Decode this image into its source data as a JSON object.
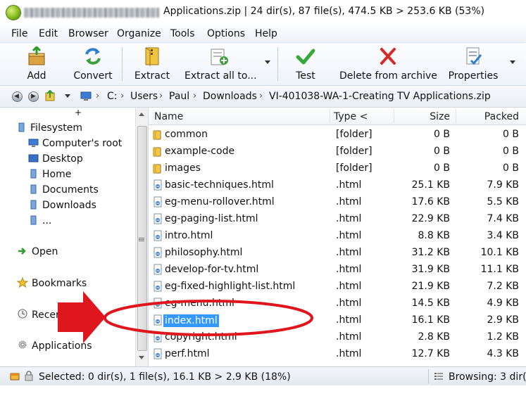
{
  "window": {
    "title": "Applications.zip | 24 dir(s), 87 file(s), 474.5 KB > 253.6 KB (53%)"
  },
  "menu": [
    "File",
    "Edit",
    "Browser",
    "Organize",
    "Tools",
    "Options",
    "Help"
  ],
  "toolbar": {
    "add": "Add",
    "convert": "Convert",
    "extract": "Extract",
    "extract_all": "Extract all to...",
    "test": "Test",
    "delete": "Delete from archive",
    "properties": "Properties"
  },
  "address": {
    "crumbs": [
      "C:",
      "Users",
      "Paul",
      "Downloads",
      "VI-401038-WA-1-Creating TV Applications.zip"
    ]
  },
  "sidebar": {
    "plus": "+",
    "filesystem": "Filesystem",
    "items": [
      "Computer's root",
      "Desktop",
      "Home",
      "Documents",
      "Downloads",
      "..."
    ],
    "open": "Open",
    "bookmarks": "Bookmarks",
    "recent": "Recent files",
    "applications": "Applications"
  },
  "columns": {
    "name": "Name",
    "type": "Type <",
    "size": "Size",
    "packed": "Packed"
  },
  "files": [
    {
      "name": "common",
      "type": "[folder]",
      "size": "0 B",
      "packed": "0 B",
      "kind": "folder"
    },
    {
      "name": "example-code",
      "type": "[folder]",
      "size": "0 B",
      "packed": "0 B",
      "kind": "folder"
    },
    {
      "name": "images",
      "type": "[folder]",
      "size": "0 B",
      "packed": "0 B",
      "kind": "folder"
    },
    {
      "name": "basic-techniques.html",
      "type": ".html",
      "size": "25.1 KB",
      "packed": "7.9 KB",
      "kind": "html"
    },
    {
      "name": "eg-menu-rollover.html",
      "type": ".html",
      "size": "17.6 KB",
      "packed": "5.5 KB",
      "kind": "html"
    },
    {
      "name": "eg-paging-list.html",
      "type": ".html",
      "size": "22.9 KB",
      "packed": "7.4 KB",
      "kind": "html"
    },
    {
      "name": "intro.html",
      "type": ".html",
      "size": "8.8 KB",
      "packed": "3.4 KB",
      "kind": "html"
    },
    {
      "name": "philosophy.html",
      "type": ".html",
      "size": "31.2 KB",
      "packed": "10.1 KB",
      "kind": "html"
    },
    {
      "name": "develop-for-tv.html",
      "type": ".html",
      "size": "31.9 KB",
      "packed": "11.1 KB",
      "kind": "html"
    },
    {
      "name": "eg-fixed-highlight-list.html",
      "type": ".html",
      "size": "21.9 KB",
      "packed": "7.2 KB",
      "kind": "html"
    },
    {
      "name": "eg-menu.html",
      "type": ".html",
      "size": "14.5 KB",
      "packed": "4.9 KB",
      "kind": "html"
    },
    {
      "name": "index.html",
      "type": ".html",
      "size": "16.1 KB",
      "packed": "2.9 KB",
      "kind": "html",
      "selected": true
    },
    {
      "name": "copyright.html",
      "type": ".html",
      "size": "2.8 KB",
      "packed": "1.2 KB",
      "kind": "html"
    },
    {
      "name": "perf.html",
      "type": ".html",
      "size": "12.7 KB",
      "packed": "4.3 KB",
      "kind": "html"
    }
  ],
  "status": {
    "selected": "Selected: 0 dir(s), 1 file(s), 16.1 KB > 2.9 KB (18%)",
    "browsing": "Browsing: 3 dir("
  },
  "colors": {
    "selection": "#3399ff",
    "annotation": "#e0161e",
    "folder": "#f2c94c"
  }
}
